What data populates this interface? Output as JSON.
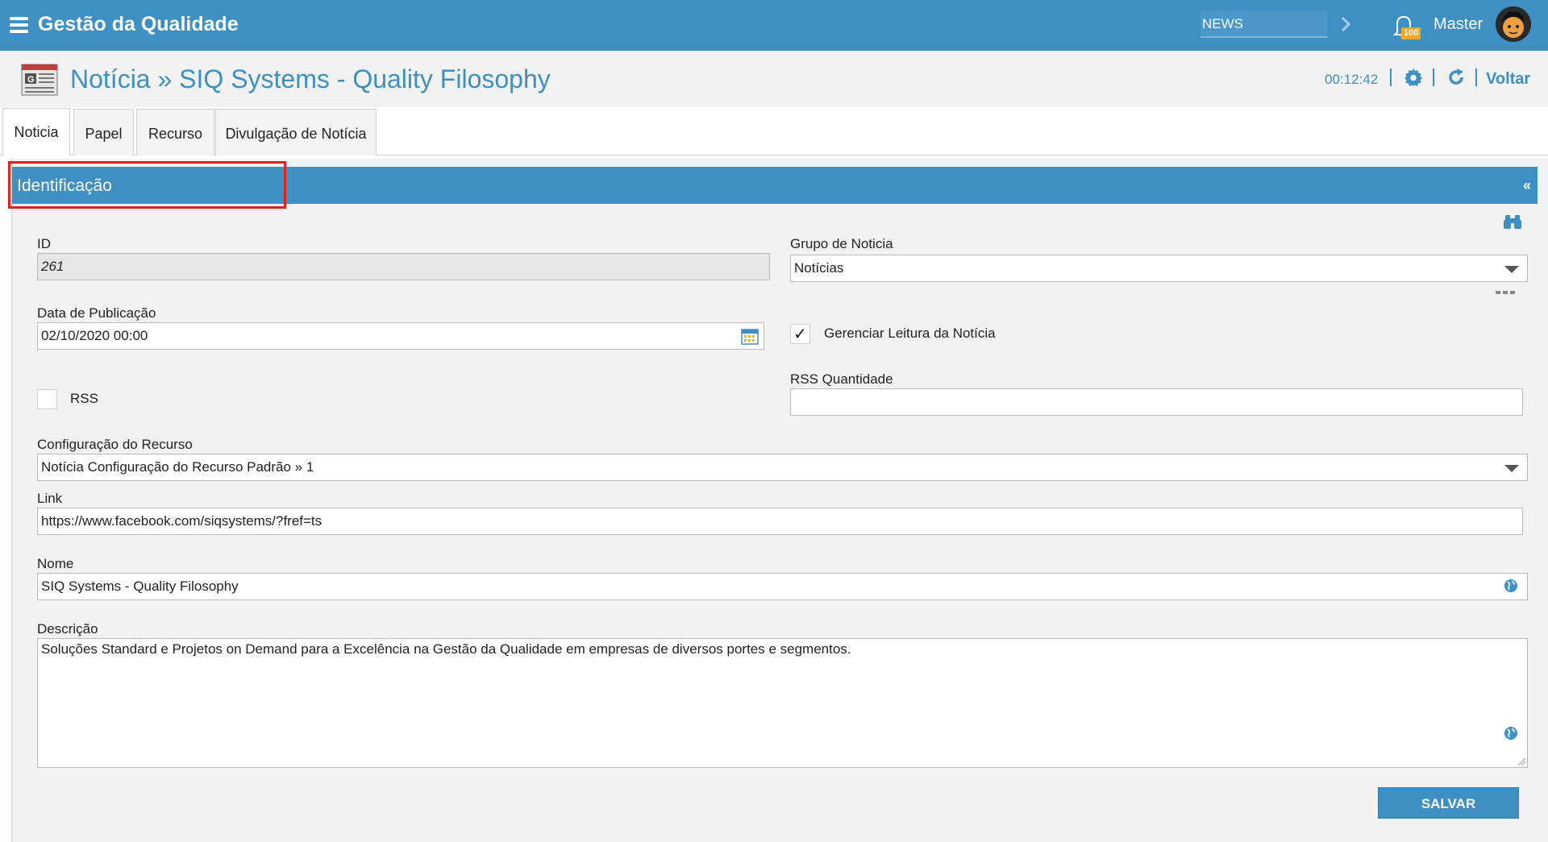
{
  "app": {
    "title": "Gestão da Qualidade"
  },
  "topbar": {
    "news_label": "NEWS",
    "notification_count": "100",
    "user_name": "Master"
  },
  "header": {
    "title": "Notícia » SIQ Systems - Quality Filosophy",
    "timer": "00:12:42",
    "back_label": "Voltar"
  },
  "tabs": [
    {
      "label": "Noticia",
      "active": true
    },
    {
      "label": "Papel",
      "active": false
    },
    {
      "label": "Recurso",
      "active": false
    },
    {
      "label": "Divulgação de Notícia",
      "active": false
    }
  ],
  "section": {
    "title": "Identificação",
    "collapse_symbol": "«"
  },
  "form": {
    "id_label": "ID",
    "id_value": "261",
    "grupo_label": "Grupo de Noticia",
    "grupo_value": "Notícias",
    "data_label": "Data de Publicação",
    "data_value": "02/10/2020 00:00",
    "gerenciar_label": "Gerenciar Leitura da Notícia",
    "gerenciar_checked": true,
    "rss_label": "RSS",
    "rss_checked": false,
    "rss_qtd_label": "RSS Quantidade",
    "rss_qtd_value": "",
    "config_label": "Configuração do Recurso",
    "config_value": "Notícia Configuração do Recurso Padrão » 1",
    "link_label": "Link",
    "link_value": "https://www.facebook.com/siqsystems/?fref=ts",
    "nome_label": "Nome",
    "nome_value": "SIQ Systems - Quality Filosophy",
    "descricao_label": "Descrição",
    "descricao_value": "Soluções Standard e Projetos on Demand para a Excelência na Gestão da Qualidade em empresas de diversos portes e segmentos.",
    "save_label": "SALVAR"
  },
  "colors": {
    "primary": "#3d8fc4",
    "highlight": "#e02020",
    "badge": "#f5a623"
  }
}
